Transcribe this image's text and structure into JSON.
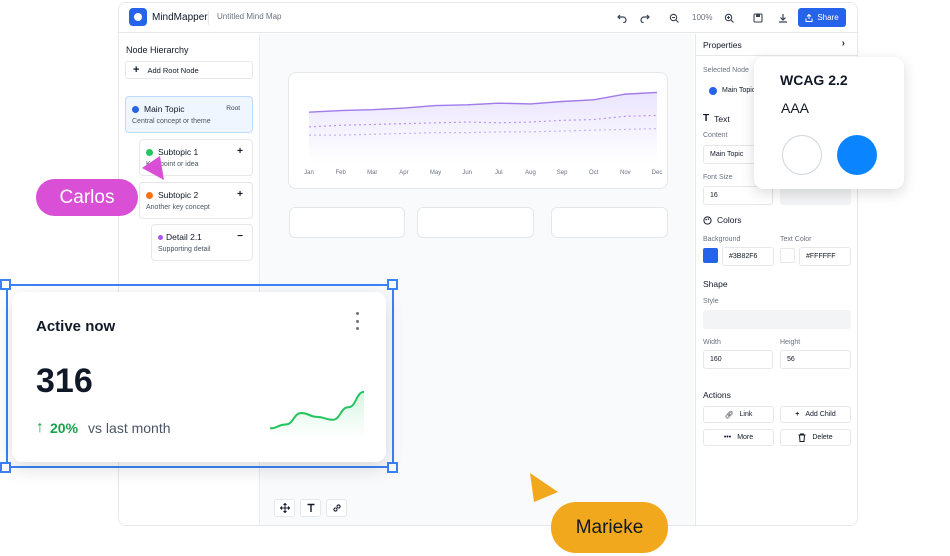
{
  "app": {
    "brand": "MindMapper",
    "doc_title": "Untitled Mind Map",
    "zoom": "100%",
    "share_label": "Share",
    "icons": [
      "undo-icon",
      "redo-icon",
      "zoom-out-icon",
      "zoom-in-icon",
      "save-icon",
      "download-icon",
      "share-icon"
    ]
  },
  "sidebar": {
    "title": "Node Hierarchy",
    "add_root_label": "Add Root Node",
    "nodes": [
      {
        "title": "Main Topic",
        "subtitle": "Central concept or theme",
        "badge": "Root",
        "color": "#2563eb"
      },
      {
        "title": "Subtopic 1",
        "subtitle": "Key point or idea",
        "action": "+",
        "color": "#22c55e"
      },
      {
        "title": "Subtopic 2",
        "subtitle": "Another key concept",
        "action": "+",
        "color": "#f97316"
      },
      {
        "title": "Detail 2.1",
        "subtitle": "Supporting detail",
        "action": "−",
        "color": "#a855f7"
      }
    ]
  },
  "chart_data": {
    "type": "line",
    "categories": [
      "Jan",
      "Feb",
      "Mar",
      "Apr",
      "May",
      "Jun",
      "Jul",
      "Aug",
      "Sep",
      "Oct",
      "Nov",
      "Dec"
    ],
    "series": [
      {
        "values": [
          62,
          64,
          65,
          67,
          70,
          71,
          73,
          72,
          75,
          77,
          84,
          86
        ],
        "style": "solid",
        "color": "#9f7aea"
      },
      {
        "values": [
          44,
          46,
          47,
          48,
          49,
          50,
          49,
          50,
          52,
          53,
          57,
          58
        ],
        "style": "dotted",
        "color": "#b794f4"
      },
      {
        "values": [
          34,
          34,
          35,
          36,
          37,
          37,
          38,
          38,
          39,
          40,
          41,
          42
        ],
        "style": "dotted",
        "color": "#c4b5fd"
      }
    ],
    "title": "",
    "xlabel": "",
    "ylabel": "",
    "ylim": [
      0,
      100
    ],
    "grid": false
  },
  "toolbar_bottom": [
    "move-icon",
    "text-icon",
    "link-icon"
  ],
  "properties": {
    "title": "Properties",
    "selected_node_label": "Selected Node",
    "selected_node_value": "Main Topic",
    "text_section": "Text",
    "content_label": "Content",
    "content_value": "Main Topic",
    "font_size_label": "Font Size",
    "font_size_value": "16",
    "colors_section": "Colors",
    "background_label": "Background",
    "background_value": "#3B82F6",
    "text_color_label": "Text Color",
    "text_color_value": "#FFFFFF",
    "shape_section": "Shape",
    "style_label": "Style",
    "width_label": "Width",
    "width_value": "160",
    "height_label": "Height",
    "height_value": "56",
    "actions_section": "Actions",
    "actions": {
      "link": "Link",
      "add_child": "Add Child",
      "more": "More",
      "delete": "Delete"
    }
  },
  "wcag": {
    "title": "WCAG 2.2",
    "level": "AAA",
    "fg_color": "#FFFFFF",
    "bg_color": "#0A84FF"
  },
  "active_card": {
    "title": "Active now",
    "value": "316",
    "change": "20%",
    "comparison": "vs last month",
    "sparkline": [
      10,
      14,
      26,
      22,
      19,
      32,
      48
    ]
  },
  "collaborators": {
    "carlos": "Carlos",
    "marieke": "Marieke"
  }
}
